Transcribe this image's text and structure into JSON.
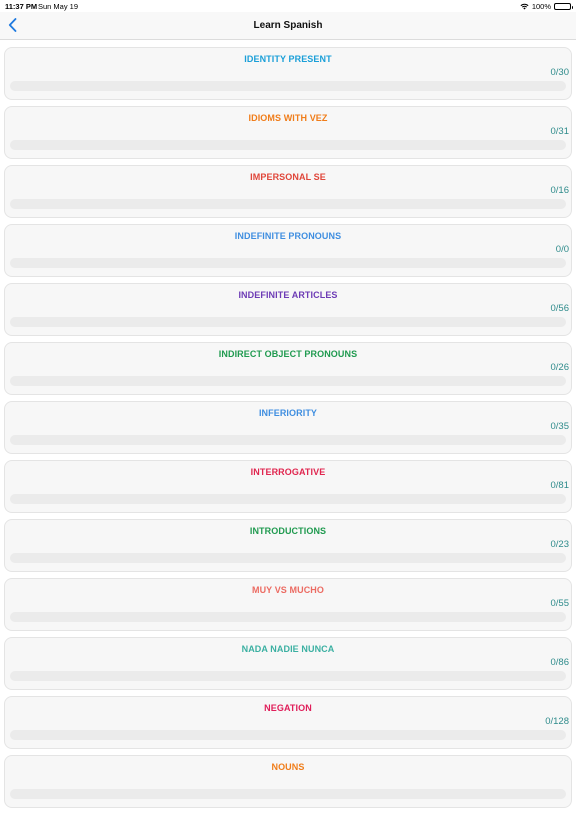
{
  "status": {
    "time": "11:37 PM",
    "date": "Sun May 19",
    "battery": "100%",
    "wifi_icon": "wifi-icon",
    "battery_icon": "battery-icon"
  },
  "nav": {
    "title": "Learn Spanish",
    "back_icon": "chevron-left-icon"
  },
  "accent_color": "#2e8b8b",
  "lessons": [
    {
      "title": "IDENTITY PRESENT",
      "count": "0/30",
      "color": "#1a9fd8",
      "progress": 0
    },
    {
      "title": "IDIOMS WITH VEZ",
      "count": "0/31",
      "color": "#f07d1a",
      "progress": 0
    },
    {
      "title": "IMPERSONAL SE",
      "count": "0/16",
      "color": "#e0463a",
      "progress": 0
    },
    {
      "title": "INDEFINITE PRONOUNS",
      "count": "0/0",
      "color": "#3f8ee0",
      "progress": 0
    },
    {
      "title": "INDEFINITE ARTICLES",
      "count": "0/56",
      "color": "#6d3bb5",
      "progress": 0
    },
    {
      "title": "INDIRECT OBJECT PRONOUNS",
      "count": "0/26",
      "color": "#1f9a4f",
      "progress": 0
    },
    {
      "title": "INFERIORITY",
      "count": "0/35",
      "color": "#3f8ee0",
      "progress": 0
    },
    {
      "title": "INTERROGATIVE",
      "count": "0/81",
      "color": "#e0264f",
      "progress": 0
    },
    {
      "title": "INTRODUCTIONS",
      "count": "0/23",
      "color": "#1f9a4f",
      "progress": 0
    },
    {
      "title": "MUY VS MUCHO",
      "count": "0/55",
      "color": "#ec6b62",
      "progress": 0
    },
    {
      "title": "NADA NADIE NUNCA",
      "count": "0/86",
      "color": "#3bb0a2",
      "progress": 0
    },
    {
      "title": "NEGATION",
      "count": "0/128",
      "color": "#e01e5a",
      "progress": 0
    },
    {
      "title": "NOUNS",
      "count": "",
      "color": "#f07d1a",
      "progress": 0
    }
  ]
}
